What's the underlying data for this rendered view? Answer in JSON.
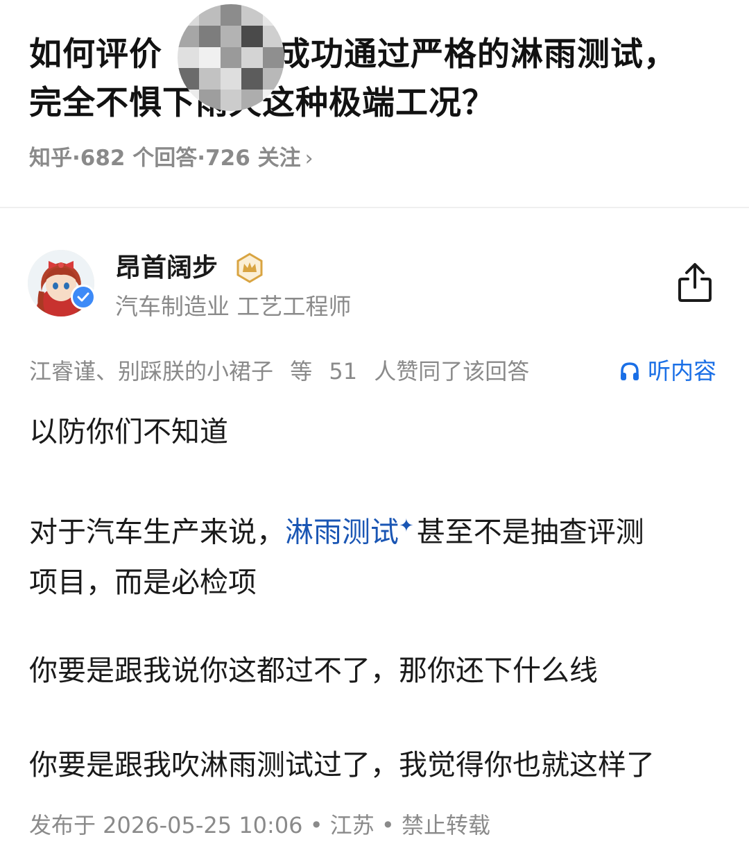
{
  "question": {
    "title_line1_a": "如何评价",
    "title_line1_b": "成功通过严格的淋雨测试，",
    "title_line2": "完全不惧下雨天这种极端工况？",
    "meta_source": "知乎",
    "meta_answers": "682 个回答",
    "meta_followers": "726 关注",
    "meta_sep": "·",
    "chevron": "›"
  },
  "author": {
    "name": "昂首阔步",
    "description": "汽车制造业 工艺工程师",
    "avatar_icon": "anime-girl-avatar",
    "verified_color": "#3d8af7",
    "badge_color": "#d9a441"
  },
  "votes": {
    "voters": "江睿谨、别踩朕的小裙子",
    "count_prefix": "等",
    "count": "51",
    "suffix": "人赞同了该回答"
  },
  "listen": {
    "label": "听内容",
    "icon": "headphones-icon",
    "color": "#1a6fe6"
  },
  "answer": {
    "p1": "以防你们不知道",
    "p2_before": "对于汽车生产来说，",
    "p2_link": "淋雨测试",
    "p2_sparkle": "✦",
    "p2_after_line1": "甚至不是抽查评测",
    "p2_line2": "项目，而是必检项",
    "p3": "你要是跟我说你这都过不了，那你还下什么线",
    "p4": "你要是跟我吹淋雨测试过了，我觉得你也就这样了"
  },
  "footer": {
    "published": "发布于 2026-05-25 10:06 • 江苏 • 禁止转载"
  }
}
